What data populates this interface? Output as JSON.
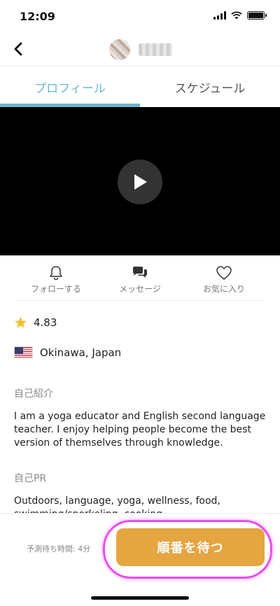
{
  "status_bar": {
    "time": "12:09"
  },
  "header": {
    "icon": "chevron-left-icon"
  },
  "tabs": [
    {
      "label": "プロフィール",
      "active": true
    },
    {
      "label": "スケジュール",
      "active": false
    }
  ],
  "actions": [
    {
      "label": "フォローする",
      "icon": "bell-icon"
    },
    {
      "label": "メッセージ",
      "icon": "chat-bubbles-icon"
    },
    {
      "label": "お気に入り",
      "icon": "heart-icon"
    }
  ],
  "profile": {
    "rating": "4.83",
    "location": "Okinawa, Japan",
    "intro_heading": "自己紹介",
    "intro_text": "I am a yoga educator and English second language teacher. I enjoy helping people become the best version of themselves through knowledge.",
    "pr_heading": "自己PR",
    "pr_text": "Outdoors, language, yoga, wellness, food, swimming/snorkeling, cooking"
  },
  "bottom": {
    "wait_label": "予測待ち時間: 4分",
    "queue_button": "順番を待つ"
  },
  "colors": {
    "accent": "#6bb8c8",
    "button": "#e5a540",
    "highlight": "#ea4cf0",
    "star": "#f2c230"
  }
}
